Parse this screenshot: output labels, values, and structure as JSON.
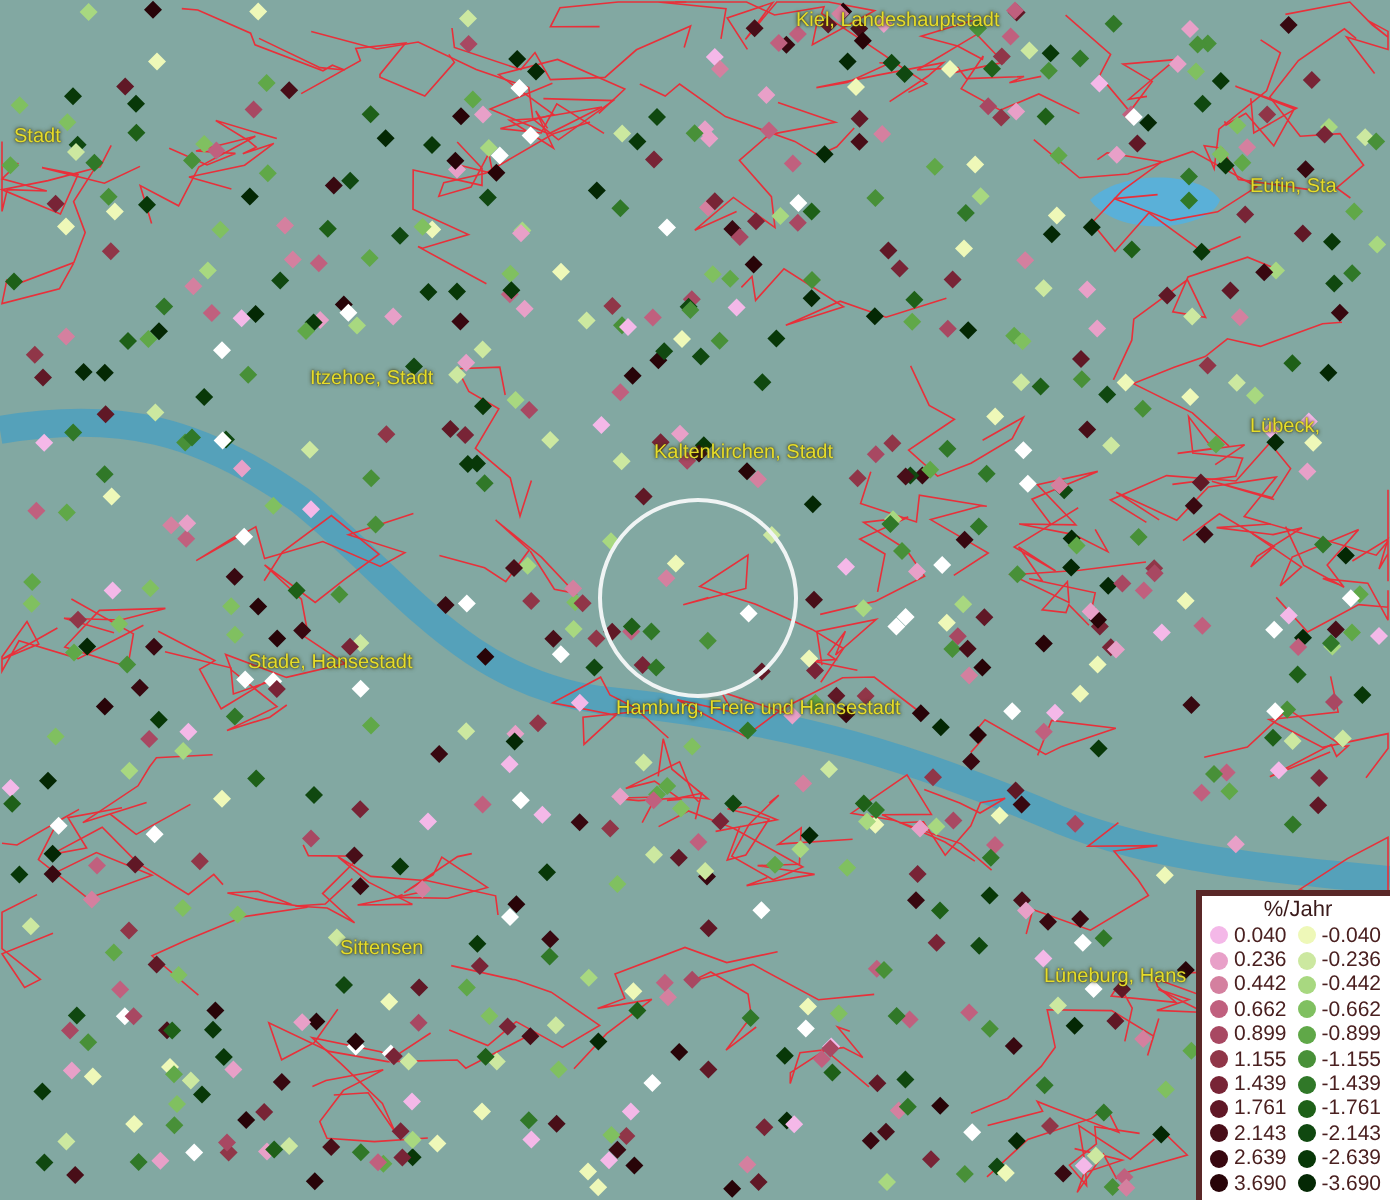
{
  "map": {
    "places": [
      {
        "name": "Kiel, Landeshauptstadt"
      },
      {
        "name": "Stadt"
      },
      {
        "name": "Eutin, Sta"
      },
      {
        "name": "Itzehoe, Stadt"
      },
      {
        "name": "Kaltenkirchen, Stadt"
      },
      {
        "name": "Lübeck,"
      },
      {
        "name": "Stade, Hansestadt"
      },
      {
        "name": "Hamburg, Freie und Hansestadt"
      },
      {
        "name": "Sittensen"
      },
      {
        "name": "Lüneburg, Hans"
      }
    ]
  },
  "legend": {
    "title": "%/Jahr",
    "entries": [
      {
        "value": "0.040",
        "color": "#f4b8e8"
      },
      {
        "value": "-0.040",
        "color": "#eef8b8"
      },
      {
        "value": "0.236",
        "color": "#e8a0c8"
      },
      {
        "value": "-0.236",
        "color": "#cce8a0"
      },
      {
        "value": "0.442",
        "color": "#d4809f"
      },
      {
        "value": "-0.442",
        "color": "#a8d880"
      },
      {
        "value": "0.662",
        "color": "#c0607e"
      },
      {
        "value": "-0.662",
        "color": "#80c060"
      },
      {
        "value": "0.899",
        "color": "#a84862"
      },
      {
        "value": "-0.899",
        "color": "#60a848"
      },
      {
        "value": "1.155",
        "color": "#903648"
      },
      {
        "value": "-1.155",
        "color": "#489038"
      },
      {
        "value": "1.439",
        "color": "#782436"
      },
      {
        "value": "-1.439",
        "color": "#307828"
      },
      {
        "value": "1.761",
        "color": "#601826"
      },
      {
        "value": "-1.761",
        "color": "#1e6018"
      },
      {
        "value": "2.143",
        "color": "#480e18"
      },
      {
        "value": "-2.143",
        "color": "#104810"
      },
      {
        "value": "2.639",
        "color": "#380810"
      },
      {
        "value": "-2.639",
        "color": "#083808"
      },
      {
        "value": "3.690",
        "color": "#280408"
      },
      {
        "value": "-3.690",
        "color": "#042804"
      }
    ]
  }
}
